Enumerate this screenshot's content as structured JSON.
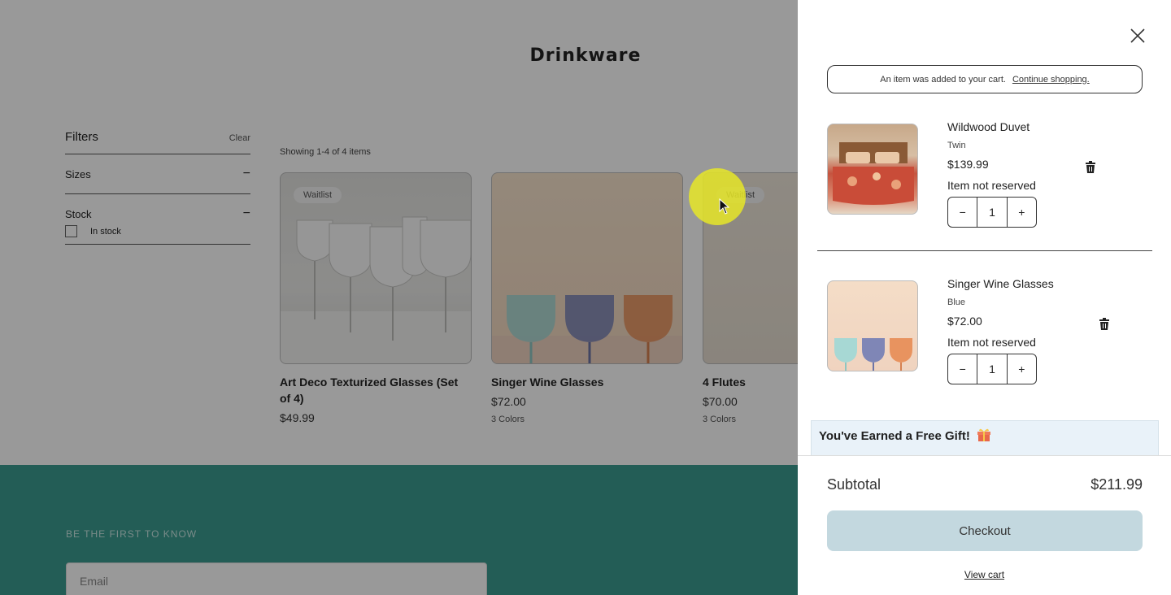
{
  "page": {
    "title": "Drinkware",
    "filters": {
      "title": "Filters",
      "clear_label": "Clear",
      "groups": [
        {
          "label": "Sizes",
          "toggle": "−"
        },
        {
          "label": "Stock",
          "toggle": "−"
        }
      ],
      "in_stock_label": "In stock"
    },
    "showing_text": "Showing 1-4 of 4 items",
    "products": [
      {
        "name": "Art Deco Texturized Glasses (Set of 4)",
        "price": "$49.99",
        "colors": "",
        "badge": "Waitlist"
      },
      {
        "name": "Singer Wine Glasses",
        "price": "$72.00",
        "colors": "3 Colors",
        "badge": ""
      },
      {
        "name": "4 Flutes",
        "price": "$70.00",
        "colors": "3 Colors",
        "badge": "Waitlist"
      }
    ],
    "footer": {
      "label": "BE THE FIRST TO KNOW",
      "email_placeholder": "Email"
    }
  },
  "cart": {
    "notice_text": "An item was added to your cart.",
    "notice_link": "Continue shopping.",
    "items": [
      {
        "name": "Wildwood Duvet",
        "variant": "Twin",
        "price": "$139.99",
        "reserve": "Item not reserved",
        "qty": "1"
      },
      {
        "name": "Singer Wine Glasses",
        "variant": "Blue",
        "price": "$72.00",
        "reserve": "Item not reserved",
        "qty": "1"
      }
    ],
    "stepper": {
      "minus": "−",
      "plus": "+"
    },
    "gift_title": "You've Earned a Free Gift!",
    "subtotal_label": "Subtotal",
    "subtotal_value": "$211.99",
    "checkout_label": "Checkout",
    "view_cart_label": "View cart"
  },
  "colors": {
    "footer_bg": "#3b9b90",
    "checkout_bg": "#c3d8df",
    "gift_bg": "#e9f2f9",
    "cursor_highlight": "#e6e628"
  }
}
